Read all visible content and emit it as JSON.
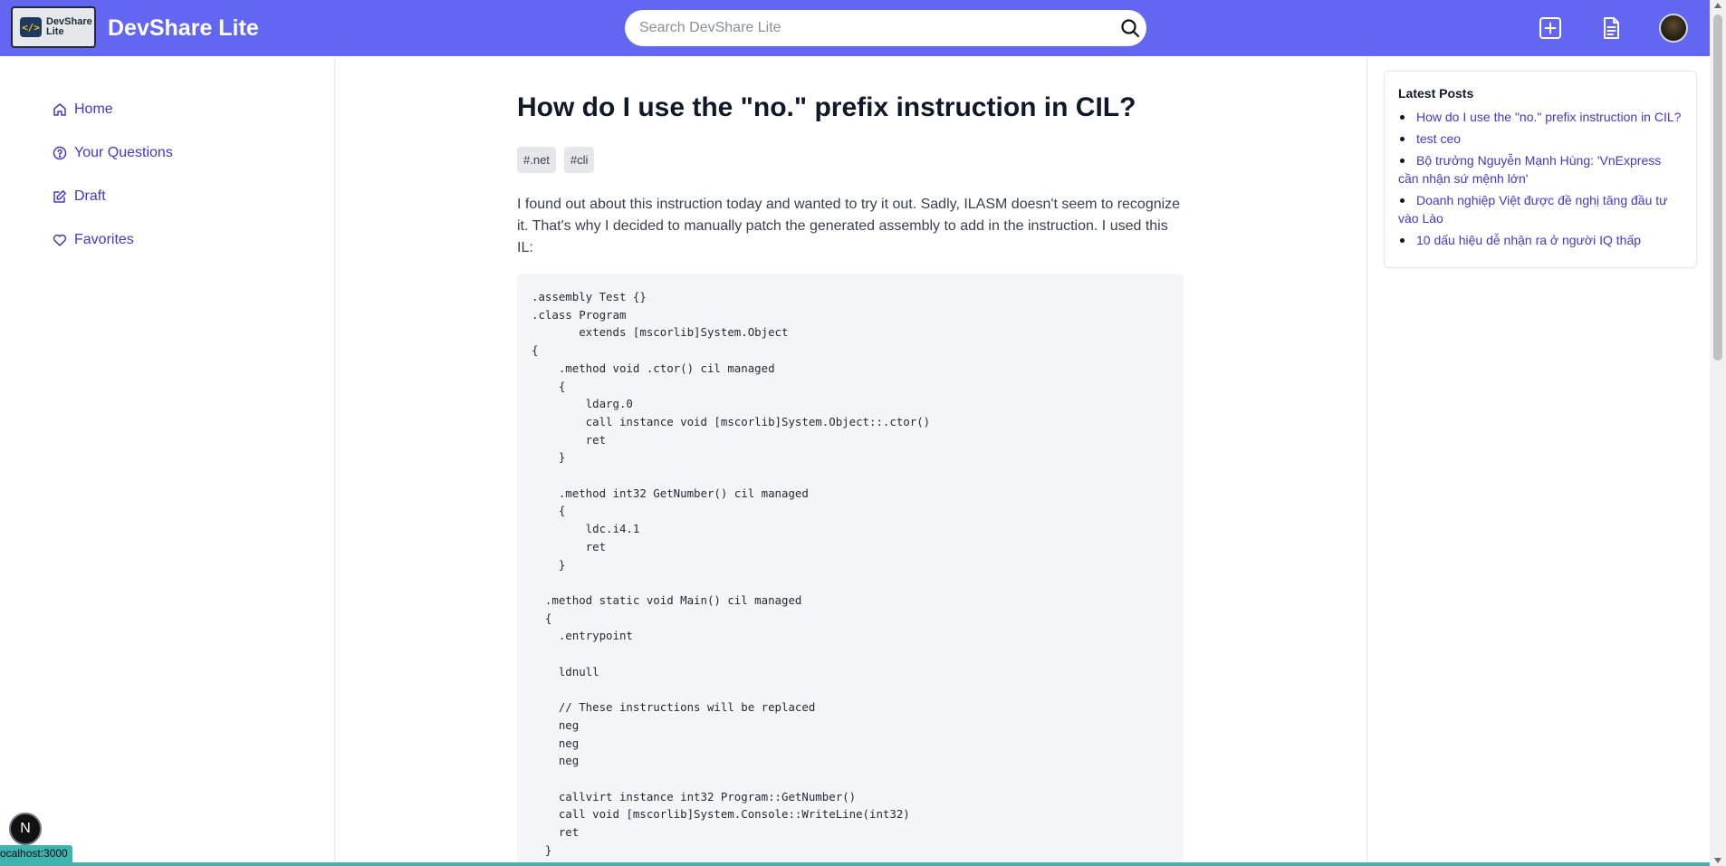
{
  "header": {
    "logo_text_line1": "DevShare",
    "logo_text_line2": "Lite",
    "logo_mark": "</>",
    "brand": "DevShare Lite",
    "search_placeholder": "Search DevShare Lite",
    "icons": [
      "search-icon",
      "plus-square-icon",
      "document-icon",
      "avatar"
    ],
    "accent_color": "#6366f1"
  },
  "sidebar": {
    "items": [
      {
        "label": "Home",
        "icon": "home-icon"
      },
      {
        "label": "Your Questions",
        "icon": "question-circle-icon"
      },
      {
        "label": "Draft",
        "icon": "edit-icon"
      },
      {
        "label": "Favorites",
        "icon": "heart-icon"
      }
    ]
  },
  "post": {
    "title": "How do I use the \"no.\" prefix instruction in CIL?",
    "tags": [
      "#.net",
      "#cli"
    ],
    "body": "I found out about this instruction today and wanted to try it out. Sadly, ILASM doesn't seem to recognize it. That's why I decided to manually patch the generated assembly to add in the instruction. I used this IL:",
    "code": ".assembly Test {}\n.class Program\n       extends [mscorlib]System.Object\n{\n    .method void .ctor() cil managed\n    {\n        ldarg.0\n        call instance void [mscorlib]System.Object::.ctor()\n        ret\n    }\n\n    .method int32 GetNumber() cil managed\n    {\n        ldc.i4.1\n        ret\n    }\n\n  .method static void Main() cil managed\n  {\n    .entrypoint\n\n    ldnull\n\n    // These instructions will be replaced\n    neg\n    neg\n    neg\n\n    callvirt instance int32 Program::GetNumber()\n    call void [mscorlib]System.Console::WriteLine(int32)\n    ret\n  }"
  },
  "latest": {
    "title": "Latest Posts",
    "items": [
      "How do I use the \"no.\" prefix instruction in CIL?",
      "test ceo",
      "Bộ trưởng Nguyễn Mạnh Hùng: 'VnExpress cần nhận sứ mệnh lớn'",
      "Doanh nghiệp Việt được đề nghị tăng đầu tư vào Lào",
      "10 dấu hiệu dễ nhận ra ở người IQ thấp"
    ]
  },
  "footer": {
    "next_badge": "N",
    "status_url": "ocalhost:3000"
  }
}
